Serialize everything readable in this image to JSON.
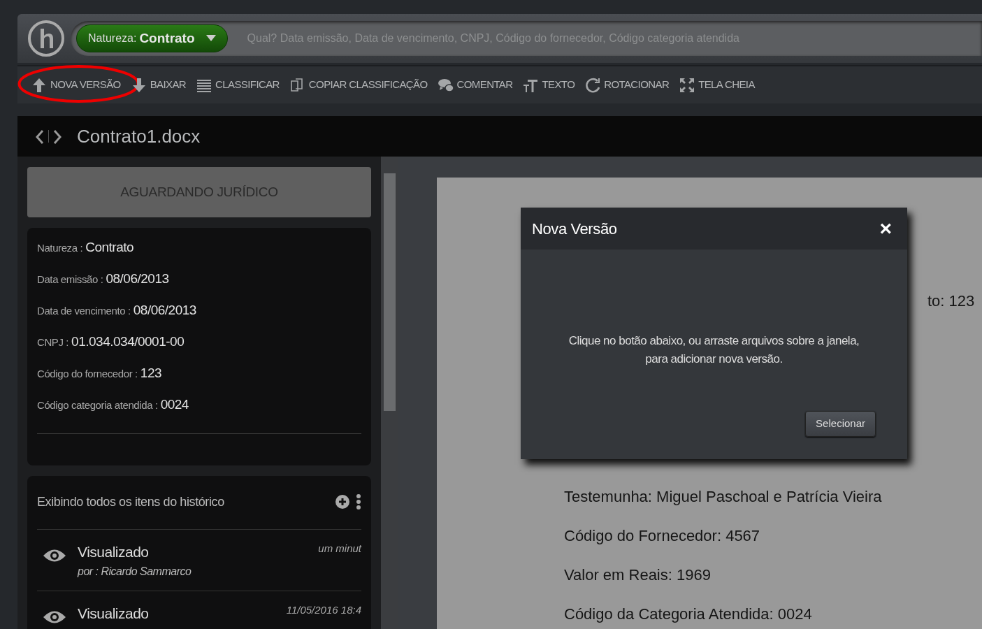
{
  "search": {
    "filter_label": "Natureza:",
    "filter_value": "Contrato",
    "placeholder": "Qual? Data emissão, Data de vencimento, CNPJ, Código do fornecedor, Código categoria atendida"
  },
  "toolbar": [
    {
      "kind": "upload",
      "label": "NOVA VERSÃO",
      "highlighted": true
    },
    {
      "kind": "download",
      "label": "BAIXAR",
      "highlighted": false
    },
    {
      "kind": "list",
      "label": "CLASSIFICAR",
      "highlighted": false
    },
    {
      "kind": "copy",
      "label": "COPIAR CLASSIFICAÇÃO",
      "highlighted": false
    },
    {
      "kind": "comment",
      "label": "COMENTAR",
      "highlighted": false
    },
    {
      "kind": "text",
      "label": "TEXTO",
      "highlighted": false
    },
    {
      "kind": "rotate",
      "label": "ROTACIONAR",
      "highlighted": false
    },
    {
      "kind": "fullscreen",
      "label": "TELA CHEIA",
      "highlighted": false
    }
  ],
  "document": {
    "title": "Contrato1.docx"
  },
  "status": "AGUARDANDO JURÍDICO",
  "fields": [
    {
      "label": "Natureza :",
      "value": "Contrato"
    },
    {
      "label": "Data emissão :",
      "value": "08/06/2013"
    },
    {
      "label": "Data de vencimento :",
      "value": "08/06/2013"
    },
    {
      "label": "CNPJ :",
      "value": "01.034.034/0001-00"
    },
    {
      "label": "Código do fornecedor :",
      "value": "123"
    },
    {
      "label": "Código categoria atendida :",
      "value": "0024"
    }
  ],
  "history": {
    "title": "Exibindo todos os itens do histórico",
    "items": [
      {
        "action": "Visualizado",
        "by": "por : Ricardo Sammarco",
        "time": "um minut"
      },
      {
        "action": "Visualizado",
        "time": "11/05/2016 18:4"
      }
    ]
  },
  "page_lines": [
    "to: 123",
    "Testemunha: Miguel Paschoal e Patrícia Vieira",
    "Código do Fornecedor: 4567",
    "Valor em Reais: 1969",
    "Código da Categoria Atendida: 0024"
  ],
  "dialog": {
    "title": "Nova Versão",
    "close": "×",
    "message": "Clique no botão abaixo, ou arraste arquivos sobre a janela, para adicionar nova versão.",
    "button": "Selecionar"
  }
}
